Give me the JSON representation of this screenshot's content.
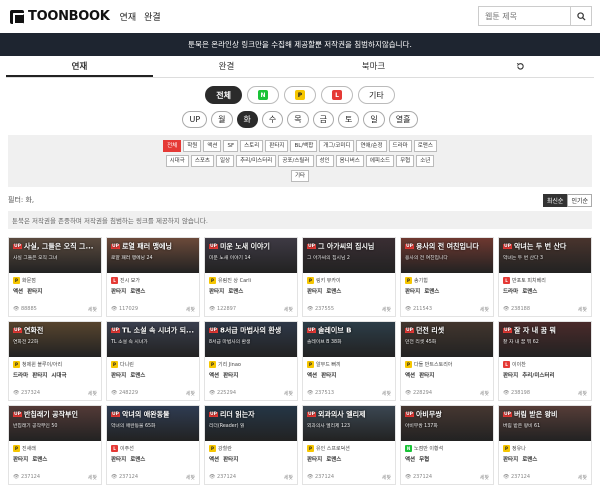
{
  "header": {
    "logo": "TOONBOOK",
    "nav": [
      "연재",
      "완결"
    ],
    "search_placeholder": "웹툰 제목"
  },
  "notice": "툰북은 온라인상 링크만을 수집해 제공할뿐 저작권을 침범하지않습니다.",
  "main_tabs": [
    "연재",
    "완결",
    "북마크"
  ],
  "platforms": [
    {
      "label": "전체",
      "active": true
    },
    {
      "label": "",
      "icon": "N",
      "color": "#19c337"
    },
    {
      "label": "",
      "icon": "P",
      "color": "#f6c600"
    },
    {
      "label": "",
      "icon": "L",
      "color": "#e53935"
    },
    {
      "label": "기타"
    }
  ],
  "days": [
    "UP",
    "월",
    "화",
    "수",
    "목",
    "금",
    "토",
    "일",
    "열흘"
  ],
  "active_day": "화",
  "genres": [
    [
      "전체",
      "학원",
      "액션",
      "SF",
      "스토리",
      "판타지",
      "BL/백합",
      "개그/코미디",
      "연애/순정",
      "드라마",
      "로맨스"
    ],
    [
      "시대극",
      "스포츠",
      "일상",
      "추리/미스터리",
      "공포/스릴러",
      "성인",
      "옴니버스",
      "에피소드",
      "무협",
      "소년"
    ],
    [
      "기타"
    ]
  ],
  "filter_text": "필터: 화,",
  "sort": [
    "최신순",
    "인기순"
  ],
  "disclaimer": "툰북은 저작권을 존중하며 저작권을 침범하는 링크를 제공하지 않습니다.",
  "cards": [
    {
      "title": "사실, 그들은 오직 그...",
      "sub": "사실 그들은 오직 그녀",
      "author": "화문점",
      "plat": "P",
      "tags": [
        "액션",
        "판타지"
      ],
      "views": "88885",
      "status": "세찾",
      "bg": "#5a4a3e"
    },
    {
      "title": "로열 패러 맹에닝",
      "sub": "로얄 패러 맹에닝 24",
      "author": "진시 묘가",
      "plat": "L",
      "tags": [
        "판타지",
        "로맨스"
      ],
      "views": "117029",
      "status": "세찾",
      "bg": "#6b4a3a"
    },
    {
      "title": "미운 노새 이야기",
      "sub": "미운 노새 이야기 14",
      "author": "유림진 상 Carli",
      "plat": "P",
      "tags": [
        "판타지",
        "로맨스"
      ],
      "views": "122897",
      "status": "세찾",
      "bg": "#3e3a44"
    },
    {
      "title": "그 아가씨의 집시님",
      "sub": "그 아가씨의 집시님 2",
      "author": "링키 뷰카이",
      "plat": "P",
      "tags": [
        "판타지",
        "로맨스"
      ],
      "views": "237555",
      "status": "세찾",
      "bg": "#3a2e33"
    },
    {
      "title": "용사의 전 여친입니다",
      "sub": "용사의 전 여친입니다",
      "author": "송기힘",
      "plat": "P",
      "tags": [
        "판타지",
        "로맨스"
      ],
      "views": "211543",
      "status": "세찾",
      "bg": "#6e3830"
    },
    {
      "title": "악녀는 두 번 산다",
      "sub": "악녀는 두 번 산다 3",
      "author": "반포토 피치베리",
      "plat": "L",
      "tags": [
        "드라마",
        "로맨스"
      ],
      "views": "238188",
      "status": "세찾",
      "bg": "#49342d"
    },
    {
      "title": "연화전",
      "sub": "연화전 22화",
      "author": "청제윈 블루이/아리",
      "plat": "P",
      "tags": [
        "드라마",
        "판타지",
        "시대극"
      ],
      "views": "237324",
      "status": "세찾",
      "bg": "#57442e"
    },
    {
      "title": "TL 소설 속 시녀가 되...",
      "sub": "TL 소설 속 시녀가",
      "author": "다니린",
      "plat": "P",
      "tags": [
        "판타지",
        "로맨스"
      ],
      "views": "248229",
      "status": "세찾",
      "bg": "#3a3f4e"
    },
    {
      "title": "8서급 마법사의 환생",
      "sub": "8서급 마법사의 환생",
      "author": "기리 Jinao",
      "plat": "P",
      "tags": [
        "액션",
        "판타지"
      ],
      "views": "225294",
      "status": "세찾",
      "bg": "#2e3848"
    },
    {
      "title": "솔레이브 B",
      "sub": "솔레이브 B 38화",
      "author": "알무드 뻐끼",
      "plat": "P",
      "tags": [
        "액션",
        "판타지"
      ],
      "views": "237513",
      "status": "세찾",
      "bg": "#2c3d48"
    },
    {
      "title": "던전 리셋",
      "sub": "던전 리셋 45화",
      "author": "다들 반트스토리아",
      "plat": "P",
      "tags": [
        "액션",
        "판타지"
      ],
      "views": "228294",
      "status": "세찾",
      "bg": "#42362e"
    },
    {
      "title": "잘 자 내 꿈 뭐",
      "sub": "잘 자 내 꿈 뭐 62",
      "author": "이이찬",
      "plat": "L",
      "tags": [
        "판타지",
        "추리/미스터리"
      ],
      "views": "238198",
      "status": "세찾",
      "bg": "#4a2a2a"
    },
    {
      "title": "반칩래기 공작부인",
      "sub": "반칩래기 공작부인 50",
      "author": "진새래",
      "plat": "P",
      "tags": [
        "판타지",
        "로맨스"
      ],
      "views": "237124",
      "status": "세찾",
      "bg": "#533a37"
    },
    {
      "title": "악녀의 애완동물",
      "sub": "악녀의 애완동물 65화",
      "author": "이주선",
      "plat": "L",
      "tags": [
        "판타지",
        "로맨스"
      ],
      "views": "237124",
      "status": "세찾",
      "bg": "#2f3c52"
    },
    {
      "title": "리더 읽는자",
      "sub": "리더(Reader) 읽",
      "author": "강힐란",
      "plat": "P",
      "tags": [
        "액션",
        "판타지"
      ],
      "views": "237124",
      "status": "세찾",
      "bg": "#253646"
    },
    {
      "title": "외과의사 엘리제",
      "sub": "외과의사 엘리제 123",
      "author": "유인 스프로덕션",
      "plat": "P",
      "tags": [
        "판타지",
        "로맨스"
      ],
      "views": "237124",
      "status": "세찾",
      "bg": "#3b4752"
    },
    {
      "title": "아비무쌍",
      "sub": "아비무쌍 137화",
      "author": "노점만 이황석",
      "plat": "N",
      "tags": [
        "액션",
        "무협"
      ],
      "views": "237124",
      "status": "세찾",
      "bg": "#463731"
    },
    {
      "title": "버림 받은 왕비",
      "sub": "버림 받은 왕비 61",
      "author": "정유나",
      "plat": "P",
      "tags": [
        "판타지",
        "로맨스"
      ],
      "views": "237124",
      "status": "세찾",
      "bg": "#563d38"
    }
  ]
}
